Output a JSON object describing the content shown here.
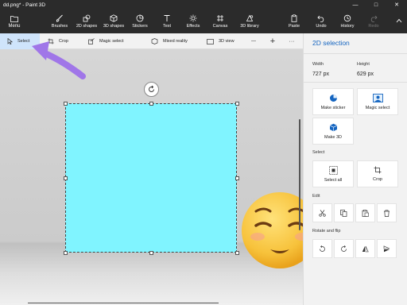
{
  "window": {
    "title": "dd.png* - Paint 3D",
    "minimize": "—",
    "maximize": "□",
    "close": "✕"
  },
  "ribbon": {
    "menu_label": "Menu",
    "tools": [
      {
        "label": "Brushes"
      },
      {
        "label": "2D shapes"
      },
      {
        "label": "3D shapes"
      },
      {
        "label": "Stickers"
      },
      {
        "label": "Text"
      },
      {
        "label": "Effects"
      },
      {
        "label": "Canvas"
      },
      {
        "label": "3D library"
      },
      {
        "label": "Paste"
      },
      {
        "label": "Undo"
      },
      {
        "label": "History"
      },
      {
        "label": "Redo"
      }
    ]
  },
  "toolbar": {
    "select_label": "Select",
    "crop_label": "Crop",
    "magic_select_label": "Magic select",
    "mixed_reality_label": "Mixed reality",
    "view3d_label": "3D view",
    "minus_label": "—",
    "plus_label": "+",
    "more_label": "···"
  },
  "panel": {
    "title": "2D selection",
    "width_label": "Width",
    "height_label": "Height",
    "width_value": "727 px",
    "height_value": "629 px",
    "make_sticker_label": "Make sticker",
    "magic_select_label": "Magic select",
    "make3d_label": "Make 3D",
    "select_section": "Select",
    "select_all_label": "Select all",
    "crop_label": "Crop",
    "edit_section": "Edit",
    "rotate_section": "Rotate and flip"
  },
  "colors": {
    "accent": "#1565c0",
    "image_fill": "#80f4ff",
    "ribbon_bg": "#2b2b2b",
    "pointer": "#a076e8"
  }
}
